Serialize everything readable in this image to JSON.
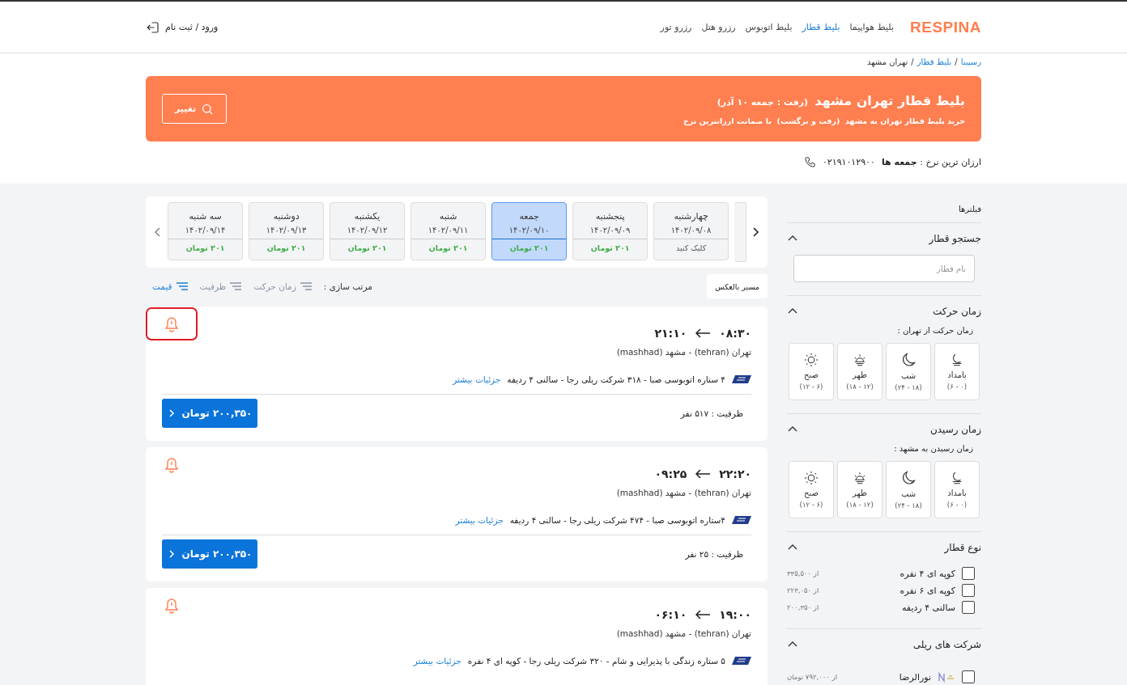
{
  "header": {
    "logo": "RESPINA",
    "nav": [
      {
        "label": "بلیط هواپیما",
        "selected": false
      },
      {
        "label": "بلیط قطار",
        "selected": true
      },
      {
        "label": "بلیط اتوبوس",
        "selected": false
      },
      {
        "label": "رزرو هتل",
        "selected": false
      },
      {
        "label": "رزرو تور",
        "selected": false
      }
    ],
    "login": "ورود / ثبت نام"
  },
  "breadcrumb": [
    {
      "label": "رسپینا",
      "kind": "link"
    },
    {
      "label": "/",
      "kind": "sep"
    },
    {
      "label": "بلیط قطار",
      "kind": "link"
    },
    {
      "label": "/",
      "kind": "sep"
    },
    {
      "label": "تهران مشهد",
      "kind": "current"
    }
  ],
  "banner": {
    "title": "بلیط قطار تهران مشهد",
    "date": "(رفت : جمعه ۱۰ آذر)",
    "subtitle": "خرید بلیط قطار تهران به مشهد  (رفت و برگشت)  با ضمانت ارزانترین نرخ",
    "button": "تغییر"
  },
  "info_line": {
    "cheapest": "ارزان ترین نرخ : **جمعه ها**",
    "phone": "۰۲۱۹۱۰۱۲۹۰۰"
  },
  "filters": {
    "title": "فیلترها",
    "sections": [
      {
        "kind": "search",
        "title": "جستجو قطار",
        "expanded": true,
        "placeholder": "نام قطار"
      },
      {
        "kind": "times",
        "title": "زمان حرکت",
        "expanded": true,
        "subtitle": "زمان حرکت از تهران :",
        "options": [
          {
            "kind": "dawn",
            "label": "بامداد",
            "range": "(۰ - ۶)"
          },
          {
            "kind": "night",
            "label": "شب",
            "range": "(۱۸ - ۲۴)"
          },
          {
            "kind": "noon",
            "label": "ظهر",
            "range": "(۱۲ - ۱۸)"
          },
          {
            "kind": "morning",
            "label": "صبح",
            "range": "(۶ - ۱۲)"
          }
        ]
      },
      {
        "kind": "times",
        "title": "زمان رسیدن",
        "expanded": true,
        "subtitle": "زمان رسیدن به مشهد :",
        "options": [
          {
            "kind": "dawn",
            "label": "بامداد",
            "range": "(۰ - ۶)"
          },
          {
            "kind": "night",
            "label": "شب",
            "range": "(۱۸ - ۲۴)"
          },
          {
            "kind": "noon",
            "label": "ظهر",
            "range": "(۱۲ - ۱۸)"
          },
          {
            "kind": "morning",
            "label": "صبح",
            "range": "(۶ - ۱۲)"
          }
        ]
      },
      {
        "kind": "checks",
        "title": "نوع قطار",
        "expanded": true,
        "items": [
          {
            "label": "کوپه ای ۴ نفره",
            "price": "از ۳۳۵,۵۰۰",
            "checked": false
          },
          {
            "label": "کوپه ای ۶ نفره",
            "price": "از ۲۲۳,۰۵۰",
            "checked": false
          },
          {
            "label": "سالنی ۴ ردیفه",
            "price": "از ۲۰۰,۳۵۰",
            "checked": false
          }
        ]
      },
      {
        "kind": "companies",
        "title": "شرکت های ریلی",
        "expanded": true,
        "items": [
          {
            "label": "نورالرضا",
            "price": "از ۷۹۲,۰۰۰ تومان",
            "checked": false
          }
        ]
      }
    ]
  },
  "dates": [
    {
      "day": "چهارشنبه",
      "date": "۱۴۰۲/۰۹/۰۸",
      "kind": "prompt",
      "note": "کلیک کنید",
      "selected": false
    },
    {
      "day": "پنجشنبه",
      "date": "۱۴۰۲/۰۹/۰۹",
      "kind": "price",
      "note": "۲۰۱ تومان",
      "selected": false
    },
    {
      "day": "جمعه",
      "date": "۱۴۰۲/۰۹/۱۰",
      "kind": "price",
      "note": "۲۰۱ تومان",
      "selected": true
    },
    {
      "day": "شنبه",
      "date": "۱۴۰۲/۰۹/۱۱",
      "kind": "price",
      "note": "۲۰۱ تومان",
      "selected": false
    },
    {
      "day": "یکشنبه",
      "date": "۱۴۰۲/۰۹/۱۲",
      "kind": "price",
      "note": "۲۰۱ تومان",
      "selected": false
    },
    {
      "day": "دوشنبه",
      "date": "۱۴۰۲/۰۹/۱۳",
      "kind": "price",
      "note": "۲۰۱ تومان",
      "selected": false
    },
    {
      "day": "سه شنبه",
      "date": "۱۴۰۲/۰۹/۱۴",
      "kind": "price",
      "note": "۲۰۱ تومان",
      "selected": false
    }
  ],
  "reverse_button": "مسیر بالعکس",
  "sort": {
    "label": "مرتب سازی :",
    "options": [
      {
        "label": "زمان حرکت",
        "selected": false
      },
      {
        "label": "ظرفیت",
        "selected": false
      },
      {
        "label": "قیمت",
        "selected": true
      }
    ]
  },
  "trips": [
    {
      "departure": "۰۸:۳۰",
      "arrival": "۲۱:۱۰",
      "route": "تهران (tehran) - مشهد (mashhad)",
      "description": "۴ ستاره اتوبوسی صبا - ۳۱۸ شرکت ریلی رجا - سالنی ۴ ردیفه",
      "details_link": "جزئیات بیشتر",
      "capacity": "ظرفیت :  ۵۱۷ نفر",
      "price": "۲۰۰,۳۵۰ تومان",
      "alert_highlighted": true
    },
    {
      "departure": "۲۲:۲۰",
      "arrival": "۰۹:۲۵",
      "route": "تهران (tehran) - مشهد (mashhad)",
      "description": "۴ستاره اتوبوسی صبا - ۴۷۴ شرکت ریلی رجا - سالنی ۴ ردیفه",
      "details_link": "جزئیات بیشتر",
      "capacity": "ظرفیت :  ۲۵ نفر",
      "price": "۲۰۰,۳۵۰ تومان",
      "alert_highlighted": false
    },
    {
      "departure": "۱۹:۰۰",
      "arrival": "۰۶:۱۰",
      "route": "تهران (tehran) - مشهد (mashhad)",
      "description": "۵ ستاره زندگی با پذیرایی و شام - ۳۲۰ شرکت ریلی رجا - کوپه ای ۴ نفره",
      "details_link": "جزئیات بیشتر",
      "alert_highlighted": false
    }
  ]
}
